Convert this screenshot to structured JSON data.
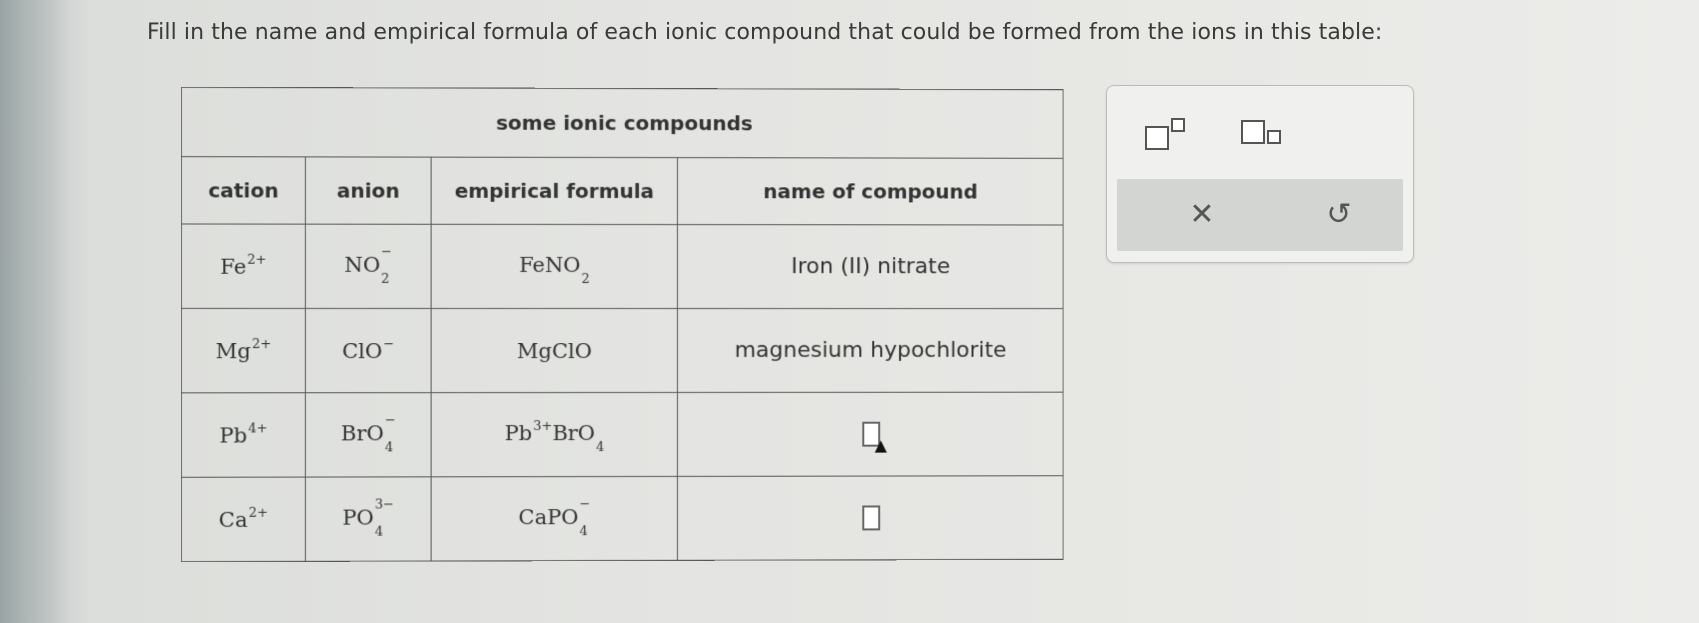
{
  "prompt": "Fill in the name and empirical formula of each ionic compound that could be formed from the ions in this table:",
  "table": {
    "caption": "some ionic compounds",
    "headers": [
      "cation",
      "anion",
      "empirical formula",
      "name of compound"
    ],
    "rows": [
      {
        "cation": {
          "base": "Fe",
          "sup": "2+"
        },
        "anion": {
          "base": "NO",
          "sub": "2",
          "sup": "−"
        },
        "formula": {
          "base": "FeNO",
          "sub": "2"
        },
        "name": "Iron (II) nitrate"
      },
      {
        "cation": {
          "base": "Mg",
          "sup": "2+"
        },
        "anion": {
          "base": "ClO",
          "sup": "−"
        },
        "formula": {
          "base": "MgClO"
        },
        "name": "magnesium hypochlorite"
      },
      {
        "cation": {
          "base": "Pb",
          "sup": "4+"
        },
        "anion": {
          "base": "BrO",
          "sub": "4",
          "sup": "−"
        },
        "formula": {
          "p1": "Pb",
          "p1sup": "3+",
          "p2": "BrO",
          "p2sub": "4"
        },
        "name": ""
      },
      {
        "cation": {
          "base": "Ca",
          "sup": "2+"
        },
        "anion": {
          "base": "PO",
          "sub": "4",
          "sup": "3−"
        },
        "formula": {
          "base": "CaPO",
          "sub": "4",
          "sup": "−"
        },
        "name": ""
      }
    ]
  },
  "toolbar": {
    "superscript_icon": "superscript-template-icon",
    "subscript_icon": "subscript-template-icon",
    "clear_icon": "✕",
    "undo_icon": "↺"
  }
}
